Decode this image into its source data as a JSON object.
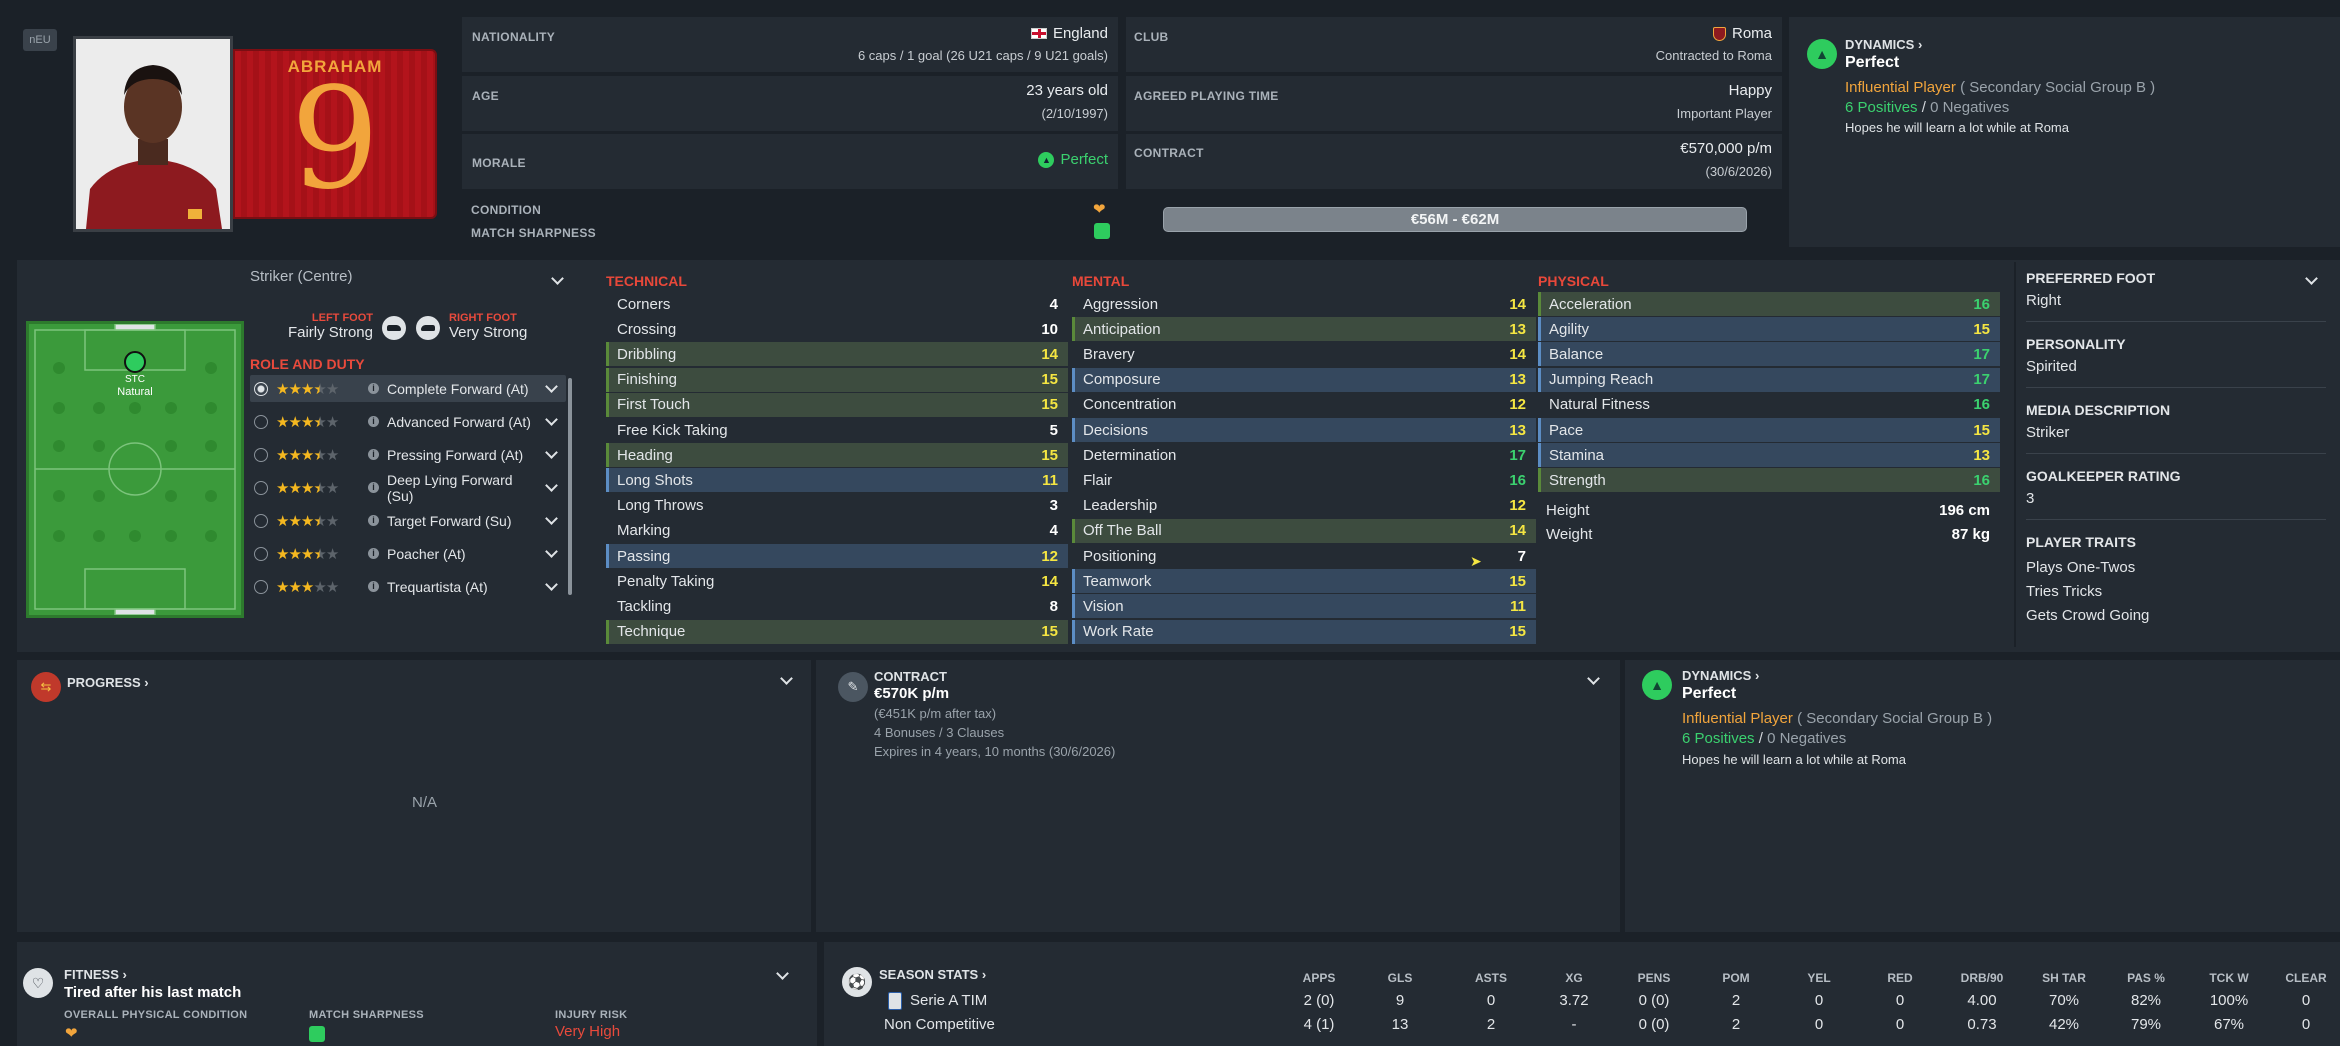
{
  "badge": "nEU",
  "player": {
    "surname": "ABRAHAM",
    "number": "9"
  },
  "info": {
    "nationality_label": "NATIONALITY",
    "nationality": "England",
    "caps": "6 caps / 1 goal (26 U21 caps / 9 U21 goals)",
    "club_label": "CLUB",
    "club": "Roma",
    "contracted": "Contracted to Roma",
    "age_label": "AGE",
    "age": "23 years old",
    "dob": "(2/10/1997)",
    "apt_label": "AGREED PLAYING TIME",
    "apt_status": "Happy",
    "apt_role": "Important Player",
    "morale_label": "MORALE",
    "morale": "Perfect",
    "contract_label": "CONTRACT",
    "wage": "€570,000 p/m",
    "expiry": "(30/6/2026)",
    "condition_label": "CONDITION",
    "sharpness_label": "MATCH SHARPNESS",
    "value_range": "€56M - €62M"
  },
  "dynamics_top": {
    "label": "DYNAMICS",
    "status": "Perfect",
    "influence": "Influential Player",
    "group": "( Secondary Social Group B )",
    "positives": "6 Positives",
    "sep": "/",
    "negatives": "0 Negatives",
    "note": "Hopes he will learn a lot while at Roma"
  },
  "position": {
    "select": "Striker (Centre)",
    "pitch_pos": "STC",
    "pitch_rating": "Natural",
    "left_foot_label": "LEFT FOOT",
    "left_foot": "Fairly Strong",
    "right_foot_label": "RIGHT FOOT",
    "right_foot": "Very Strong",
    "role_duty_label": "ROLE AND DUTY"
  },
  "roles": [
    {
      "name": "Complete Forward (At)",
      "stars": 3.5,
      "selected": true
    },
    {
      "name": "Advanced Forward (At)",
      "stars": 3.5,
      "selected": false
    },
    {
      "name": "Pressing Forward (At)",
      "stars": 3.5,
      "selected": false
    },
    {
      "name": "Deep Lying Forward (Su)",
      "stars": 3.5,
      "selected": false
    },
    {
      "name": "Target Forward (Su)",
      "stars": 3.5,
      "selected": false
    },
    {
      "name": "Poacher (At)",
      "stars": 3.5,
      "selected": false
    },
    {
      "name": "Trequartista (At)",
      "stars": 3,
      "selected": false
    }
  ],
  "technical_label": "TECHNICAL",
  "technical": [
    {
      "name": "Corners",
      "value": "4",
      "hl": ""
    },
    {
      "name": "Crossing",
      "value": "10",
      "hl": ""
    },
    {
      "name": "Dribbling",
      "value": "14",
      "hl": "g"
    },
    {
      "name": "Finishing",
      "value": "15",
      "hl": "g"
    },
    {
      "name": "First Touch",
      "value": "15",
      "hl": "g"
    },
    {
      "name": "Free Kick Taking",
      "value": "5",
      "hl": ""
    },
    {
      "name": "Heading",
      "value": "15",
      "hl": "g"
    },
    {
      "name": "Long Shots",
      "value": "11",
      "hl": "b"
    },
    {
      "name": "Long Throws",
      "value": "3",
      "hl": ""
    },
    {
      "name": "Marking",
      "value": "4",
      "hl": ""
    },
    {
      "name": "Passing",
      "value": "12",
      "hl": "b"
    },
    {
      "name": "Penalty Taking",
      "value": "14",
      "hl": ""
    },
    {
      "name": "Tackling",
      "value": "8",
      "hl": ""
    },
    {
      "name": "Technique",
      "value": "15",
      "hl": "g"
    }
  ],
  "mental_label": "MENTAL",
  "mental": [
    {
      "name": "Aggression",
      "value": "14",
      "hl": ""
    },
    {
      "name": "Anticipation",
      "value": "13",
      "hl": "g"
    },
    {
      "name": "Bravery",
      "value": "14",
      "hl": ""
    },
    {
      "name": "Composure",
      "value": "13",
      "hl": "b"
    },
    {
      "name": "Concentration",
      "value": "12",
      "hl": ""
    },
    {
      "name": "Decisions",
      "value": "13",
      "hl": "b"
    },
    {
      "name": "Determination",
      "value": "17",
      "hl": ""
    },
    {
      "name": "Flair",
      "value": "16",
      "hl": ""
    },
    {
      "name": "Leadership",
      "value": "12",
      "hl": ""
    },
    {
      "name": "Off The Ball",
      "value": "14",
      "hl": "g"
    },
    {
      "name": "Positioning",
      "value": "7",
      "hl": ""
    },
    {
      "name": "Teamwork",
      "value": "15",
      "hl": "b"
    },
    {
      "name": "Vision",
      "value": "11",
      "hl": "b"
    },
    {
      "name": "Work Rate",
      "value": "15",
      "hl": "b"
    }
  ],
  "physical_label": "PHYSICAL",
  "physical": [
    {
      "name": "Acceleration",
      "value": "16",
      "hl": "g"
    },
    {
      "name": "Agility",
      "value": "15",
      "hl": "b"
    },
    {
      "name": "Balance",
      "value": "17",
      "hl": "b"
    },
    {
      "name": "Jumping Reach",
      "value": "17",
      "hl": "b"
    },
    {
      "name": "Natural Fitness",
      "value": "16",
      "hl": ""
    },
    {
      "name": "Pace",
      "value": "15",
      "hl": "b"
    },
    {
      "name": "Stamina",
      "value": "13",
      "hl": "b"
    },
    {
      "name": "Strength",
      "value": "16",
      "hl": "g"
    }
  ],
  "height_label": "Height",
  "height": "196 cm",
  "weight_label": "Weight",
  "weight": "87 kg",
  "profile": {
    "foot_label": "PREFERRED FOOT",
    "foot": "Right",
    "personality_label": "PERSONALITY",
    "personality": "Spirited",
    "media_label": "MEDIA DESCRIPTION",
    "media": "Striker",
    "gk_label": "GOALKEEPER RATING",
    "gk": "3",
    "traits_label": "PLAYER TRAITS",
    "traits": [
      "Plays One-Twos",
      "Tries Tricks",
      "Gets Crowd Going"
    ]
  },
  "progress": {
    "label": "PROGRESS",
    "value": "N/A"
  },
  "contract_card": {
    "label": "CONTRACT",
    "wage": "€570K p/m",
    "after_tax": "(€451K p/m after tax)",
    "bonuses": "4 Bonuses / 3 Clauses",
    "expires": "Expires in 4 years, 10 months  (30/6/2026)"
  },
  "dynamics_bottom": {
    "label": "DYNAMICS",
    "status": "Perfect",
    "influence": "Influential Player",
    "group": "( Secondary Social Group B )",
    "positives": "6 Positives",
    "sep": "/",
    "negatives": "0 Negatives",
    "note": "Hopes he will learn a lot while at Roma"
  },
  "fitness": {
    "label": "FITNESS",
    "status": "Tired after his last match",
    "opc_label": "OVERALL PHYSICAL CONDITION",
    "ms_label": "MATCH SHARPNESS",
    "risk_label": "INJURY RISK",
    "risk": "Very High"
  },
  "season": {
    "label": "SEASON STATS",
    "headers": [
      "APPS",
      "GLS",
      "ASTS",
      "XG",
      "PENS",
      "POM",
      "YEL",
      "RED",
      "DRB/90",
      "SH TAR",
      "PAS %",
      "TCK W",
      "CLEAR"
    ],
    "rows": [
      {
        "comp": "Serie A TIM",
        "vals": [
          "2 (0)",
          "9",
          "0",
          "3.72",
          "0 (0)",
          "2",
          "0",
          "0",
          "4.00",
          "70%",
          "82%",
          "100%",
          "0"
        ]
      },
      {
        "comp": "Non Competitive",
        "vals": [
          "4 (1)",
          "13",
          "2",
          "-",
          "0 (0)",
          "2",
          "0",
          "0",
          "0.73",
          "42%",
          "79%",
          "67%",
          "0"
        ]
      }
    ]
  }
}
